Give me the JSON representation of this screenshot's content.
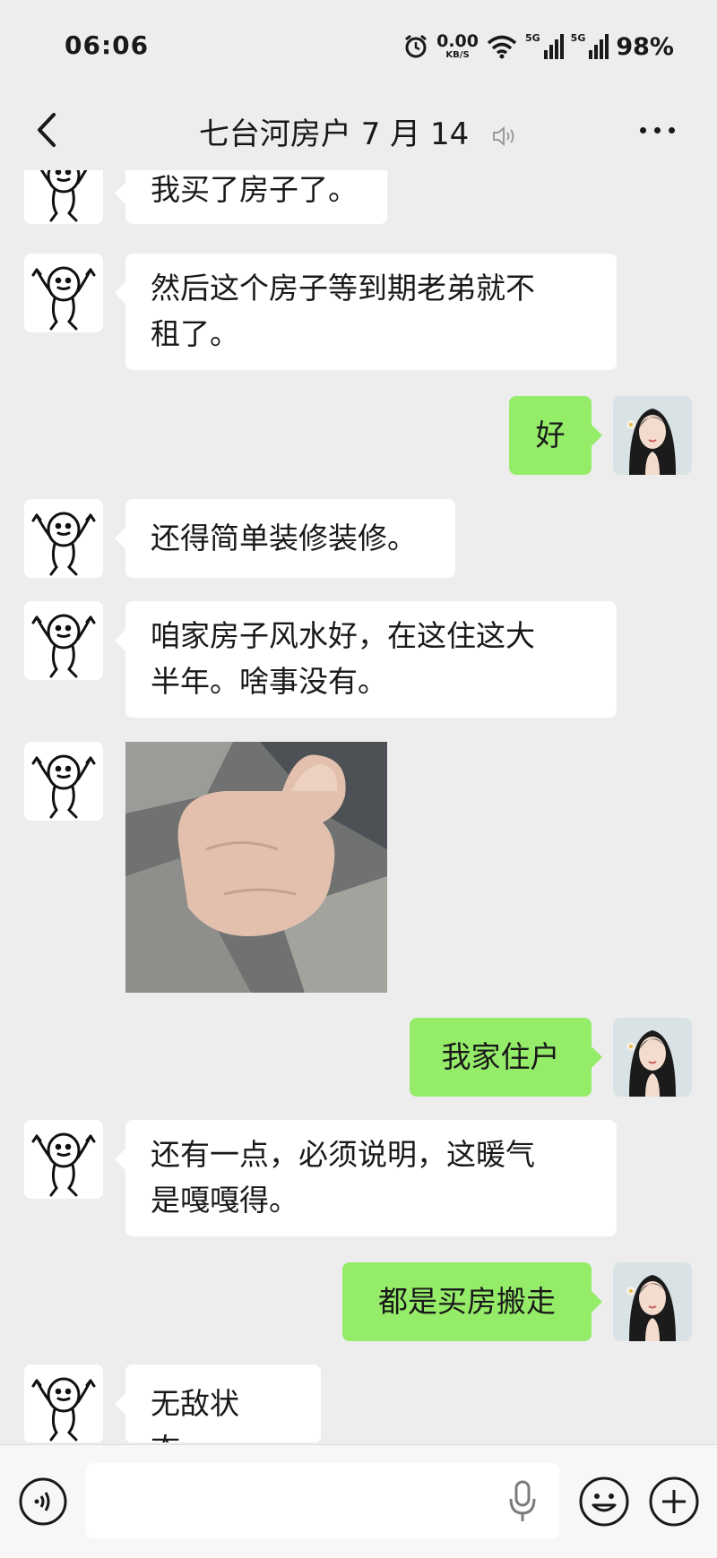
{
  "status_bar": {
    "time": "06:06",
    "net_speed_value": "0.00",
    "net_speed_unit": "KB/S",
    "sim1": "5G",
    "sim2": "5G",
    "battery": "98%"
  },
  "header": {
    "title": "七台河房户 7 月 14",
    "muted_icon": "mute-icon",
    "more_icon": "more-icon",
    "back_icon": "back-icon"
  },
  "messages": [
    {
      "side": "in",
      "text": "我买了房子了。"
    },
    {
      "side": "in",
      "text_line1": "然后这个房子等到期老弟就不",
      "text_line2": "租了。"
    },
    {
      "side": "out",
      "text": "好"
    },
    {
      "side": "in",
      "text": "还得简单装修装修。"
    },
    {
      "side": "in",
      "text_line1": "咱家房子风水好，在这住这大",
      "text_line2": "半年。啥事没有。"
    },
    {
      "side": "in",
      "type": "image",
      "image_desc": "thumbs-up-photo"
    },
    {
      "side": "out",
      "text": "我家住户"
    },
    {
      "side": "in",
      "text_line1": "还有一点，必须说明，这暖气",
      "text_line2": "是嘎嘎得。"
    },
    {
      "side": "out",
      "text": "都是买房搬走"
    },
    {
      "side": "in",
      "text": "无敌状态。"
    }
  ],
  "input_bar": {
    "placeholder": "",
    "voice_icon": "voice-input-icon",
    "mic_icon": "microphone-icon",
    "emoji_icon": "emoji-icon",
    "plus_icon": "plus-icon"
  },
  "colors": {
    "background": "#ededed",
    "incoming_bubble": "#ffffff",
    "outgoing_bubble": "#95ec69",
    "text": "#191919"
  }
}
